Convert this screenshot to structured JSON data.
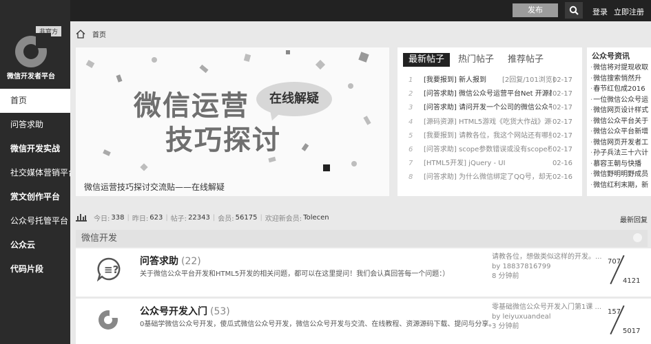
{
  "sidebar": {
    "badge": "非官方",
    "logo_text": "微信开发者平台",
    "items": [
      {
        "label": "首页"
      },
      {
        "label": "问答求助"
      },
      {
        "label": "微信开发实战"
      },
      {
        "label": "社交媒体营销平台"
      },
      {
        "label": "赏文创作平台"
      },
      {
        "label": "公众号托管平台"
      },
      {
        "label": "公众云"
      },
      {
        "label": "代码片段"
      }
    ]
  },
  "topbar": {
    "publish_label": "发布",
    "search_icon": "search-icon",
    "login_label": "登录",
    "register_label": "立即注册"
  },
  "breadcrumb": {
    "home_icon": "home-icon",
    "label": "首页"
  },
  "banner": {
    "line1": "微信运营",
    "line2": "技巧探讨",
    "bubble": "在线解疑",
    "caption": "微信运营技巧探讨交流贴——在线解疑"
  },
  "posts": {
    "tabs": [
      {
        "label": "最新帖子"
      },
      {
        "label": "热门帖子"
      },
      {
        "label": "推荐帖子"
      }
    ],
    "items": [
      {
        "num": "1",
        "text": "[我要报到] 新人报到",
        "extra": "[2回复/101浏览]",
        "date": "02-17"
      },
      {
        "num": "2",
        "text": "[问答求助] 微信公众号运营平台Net 开源都",
        "extra": "",
        "date": "02-17"
      },
      {
        "num": "3",
        "text": "[问答求助] 请问开发一个公司的微信公众平",
        "extra": "",
        "date": "02-17"
      },
      {
        "num": "4",
        "text": "[源码资源] HTML5游戏《吃货大作战》源码",
        "extra": "",
        "date": "02-17"
      },
      {
        "num": "5",
        "text": "[我要报到] 请教各位，我这个网站还有哪些",
        "extra": "",
        "date": "02-17"
      },
      {
        "num": "6",
        "text": "[问答求助] scope参数错误或没有scope权限",
        "extra": "",
        "date": "02-17"
      },
      {
        "num": "7",
        "text": "[HTML5开发] jQuery - UI",
        "extra": "",
        "date": "02-16"
      },
      {
        "num": "8",
        "text": "[问答求助] 为什么微信绑定了QQ号，却无法",
        "extra": "",
        "date": "02-16"
      }
    ]
  },
  "news": {
    "title": "公众号资讯",
    "items": [
      "微信将对提现收取",
      "微信搜索悄然升",
      "春节红包成2016",
      "一位微信公众号运",
      "微信网页设计样式",
      "微信公众平台关于",
      "微信公众平台新增",
      "微信网页开发者工",
      "孙子兵法三十六计",
      "慕容王朝与快播",
      "微信野明明野成员",
      "微信红利末期，新"
    ]
  },
  "stats": {
    "chart_icon": "bar-chart-icon",
    "today_label": "今日:",
    "today": "338",
    "yesterday_label": "昨日:",
    "yesterday": "623",
    "posts_label": "帖子:",
    "posts": "22343",
    "members_label": "会员:",
    "members": "56175",
    "welcome_label": "欢迎新会员:",
    "new_member": "Tolecen",
    "latest_reply": "最新回复"
  },
  "section": {
    "title": "微信开发",
    "forums": [
      {
        "icon": "qa-bubble-icon",
        "name": "问答求助",
        "count": "(22)",
        "desc": "关于微信公众平台开发和HTML5开发的相关问题，都可以在这里提问！我们会认真回答每一个问题：）",
        "latest_title": "请教各位，想做类似这样的开发。...",
        "latest_by": "by 18837816799",
        "latest_time": "8 分钟前",
        "topics": "707",
        "total": "4121"
      },
      {
        "icon": "platform-logo-icon",
        "name": "公众号开发入门",
        "count": "(53)",
        "desc": "0基础学微信公众号开发，傻瓜式微信公众号开发，微信公众号开发与交流、在线教程、资源源码下载、提问与分享。",
        "latest_title": "零基础微信公众号开发入门第1课 ...",
        "latest_by": "by leiyuxuandeal",
        "latest_time": "3 分钟前",
        "topics": "157",
        "total": "5017"
      }
    ]
  }
}
